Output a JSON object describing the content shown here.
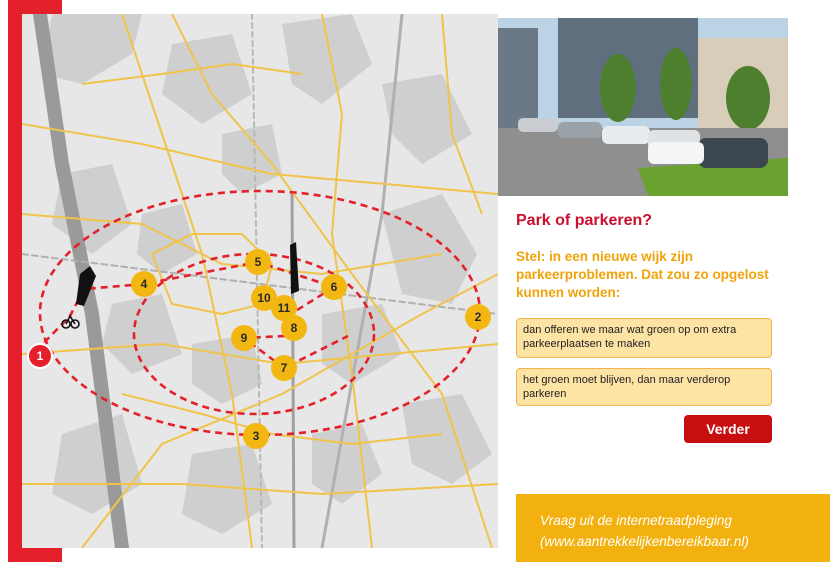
{
  "colors": {
    "brand_red": "#e4202a",
    "marker_yellow": "#f2b710",
    "road_yellow": "#f0c44a",
    "option_bg": "#fde3a4",
    "option_border": "#f1b54a",
    "title_color": "#c8102e",
    "intro_color": "#f0a30a",
    "button_bg": "#c80f0f",
    "caption_bg": "#f2b10f"
  },
  "map": {
    "markers": [
      {
        "label": "1",
        "type": "start"
      },
      {
        "label": "2",
        "type": "stop"
      },
      {
        "label": "3",
        "type": "stop"
      },
      {
        "label": "4",
        "type": "stop"
      },
      {
        "label": "5",
        "type": "stop"
      },
      {
        "label": "6",
        "type": "stop"
      },
      {
        "label": "7",
        "type": "stop"
      },
      {
        "label": "8",
        "type": "stop"
      },
      {
        "label": "9",
        "type": "stop"
      },
      {
        "label": "10",
        "type": "stop"
      },
      {
        "label": "11",
        "type": "stop"
      }
    ],
    "bike_icon": "bicycle-icon",
    "landmark_icon": "building-silhouette-icon"
  },
  "panel": {
    "title": "Park of parkeren?",
    "intro": "Stel: in een nieuwe wijk zijn parkeerproblemen. Dat zou zo opgelost kunnen worden:",
    "options": [
      {
        "label": "dan offeren we maar wat groen op om extra parkeerplaatsen te maken"
      },
      {
        "label": "het groen moet blijven, dan maar verderop parkeren"
      }
    ],
    "next_button": "Verder"
  },
  "caption": {
    "line1": "Vraag uit de internetraadpleging",
    "line2": "(www.aantrekkelijkenbereikbaar.nl)"
  }
}
